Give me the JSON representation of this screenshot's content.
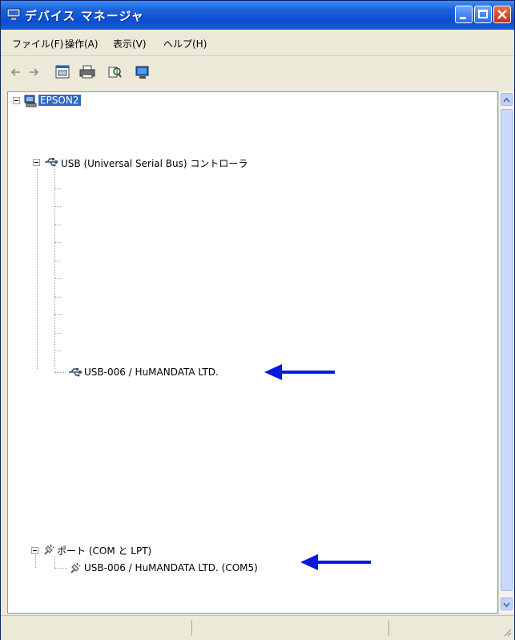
{
  "window": {
    "title": "デバイス マネージャ"
  },
  "menu": {
    "items": [
      "ファイル(F)",
      "操作(A)",
      "表示(V)",
      "ヘルプ(H)"
    ]
  },
  "tree": {
    "root": "EPSON2",
    "usb_controller": "USB (Universal Serial Bus) コントローラ",
    "usb_device": "USB-006 / HuMANDATA LTD.",
    "ports": "ポート (COM と LPT)",
    "port_device": "USB-006 / HuMANDATA LTD. (COM5)"
  },
  "colors": {
    "arrow": "#0a1ad8",
    "selection": "#316ac5",
    "titlebar": "#0a4fd0"
  }
}
